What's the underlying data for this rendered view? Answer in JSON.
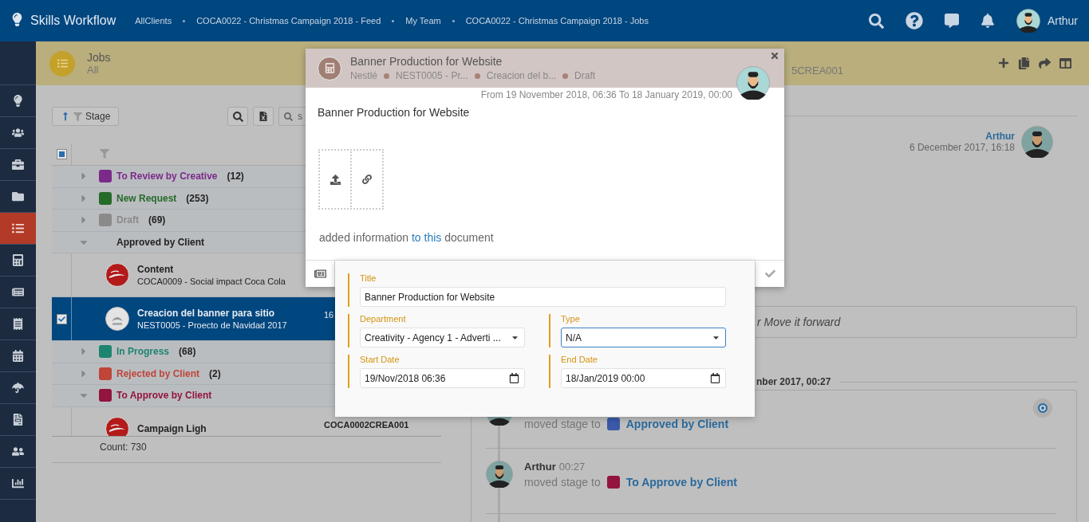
{
  "app": {
    "name": "Skills Workflow"
  },
  "breadcrumbs": [
    {
      "label": "AllClients"
    },
    {
      "label": "COCA0022 - Christmas Campaign 2018 - Feed"
    },
    {
      "label": "My Team"
    },
    {
      "label": "COCA0022 - Christmas Campaign 2018 - Jobs"
    }
  ],
  "user": {
    "name": "Arthur"
  },
  "sidebar": {
    "items": [
      {
        "kind": "bulb",
        "selected": false
      },
      {
        "kind": "team",
        "selected": false
      },
      {
        "kind": "briefcase",
        "selected": false
      },
      {
        "kind": "folder",
        "selected": false
      },
      {
        "kind": "list",
        "selected": true
      },
      {
        "kind": "calculator",
        "selected": false
      },
      {
        "kind": "newspaper",
        "selected": false
      },
      {
        "kind": "receipt",
        "selected": false
      },
      {
        "kind": "calendar",
        "selected": false
      },
      {
        "kind": "umbrella",
        "selected": false
      },
      {
        "kind": "report",
        "selected": false
      },
      {
        "kind": "people",
        "selected": false
      },
      {
        "kind": "chart",
        "selected": false
      }
    ]
  },
  "header": {
    "title": "Jobs",
    "subtitle": "All",
    "code_fragment": "5CREA001"
  },
  "toolbar": {
    "sort_button": "Stage",
    "search": {
      "placeholder": "s"
    }
  },
  "table": {
    "select_all": {
      "indeterminate": true
    },
    "groups": [
      {
        "label": "To Review by Creative",
        "count": "(12)",
        "color": "#7b2a8a",
        "expanded": false
      },
      {
        "label": "New Request",
        "count": "(253)",
        "color": "#256b2a",
        "expanded": false
      },
      {
        "label": "Draft",
        "count": "(69)",
        "color": "#8a8a8a",
        "expanded": false
      },
      {
        "label": "Approved by Client",
        "expanded": true,
        "jobs": [
          {
            "title": "Content",
            "subtitle": "COCA0009 - Social impact Coca Cola",
            "kind": "red-logo",
            "selected": false
          },
          {
            "title": "Creacion del banner para sitio",
            "subtitle": "NEST0005 - Proecto de Navidad 2017",
            "kind": "grey-logo",
            "selected": true,
            "column_3": "16"
          }
        ]
      },
      {
        "label": "In Progress",
        "count": "(68)",
        "color": "#1d8470",
        "expanded": false
      },
      {
        "label": "Rejected by Client",
        "count": "(2)",
        "color": "#bf4539",
        "expanded": false
      },
      {
        "label": "To Approve by Client",
        "color": "#93143f",
        "expanded": true,
        "jobs": [
          {
            "title": "Campaign Ligh",
            "kind": "red-logo",
            "selected": false,
            "column_3": "COCA0002CREA001"
          }
        ]
      }
    ],
    "count": "Count: 730"
  },
  "feed": {
    "comment": {
      "author": "Arthur",
      "date": "6 December 2017, 16:18"
    },
    "input_fragment": "r Move it forward",
    "timeline": {
      "date_fragment": "nber 2017, 00:27",
      "entries": [
        {
          "action": "moved stage to",
          "stage": "Approved by Client",
          "color": "#3a5aa8"
        },
        {
          "author": "Arthur",
          "time": "00:27",
          "action": "moved stage to",
          "stage": "To Approve by Client",
          "color": "#93143f"
        }
      ]
    }
  },
  "modal": {
    "title": "Banner Production for Website",
    "meta": [
      "Nestlé",
      "NEST0005 - Pr...",
      "Creacion del b...",
      "Draft"
    ],
    "period": "From 19 November 2018, 06:36 To 18 January 2019, 00:00",
    "description": "Banner Production for Website",
    "activity": {
      "before": "added information",
      "link": "to this",
      "after": "document"
    }
  },
  "form": {
    "fields": [
      {
        "kind": "text",
        "label": "Title",
        "value": "Banner Production for Website",
        "focused": false
      },
      {
        "kind": "select",
        "label": "Department",
        "value": "Creativity - Agency 1 - Adverti ...",
        "focused": false
      },
      {
        "kind": "select",
        "label": "Type",
        "value": "N/A",
        "focused": true
      },
      {
        "kind": "date",
        "label": "Start Date",
        "value": "19/Nov/2018 06:36",
        "focused": false
      },
      {
        "kind": "date",
        "label": "End Date",
        "value": "18/Jan/2019 00:00",
        "focused": false
      }
    ]
  }
}
